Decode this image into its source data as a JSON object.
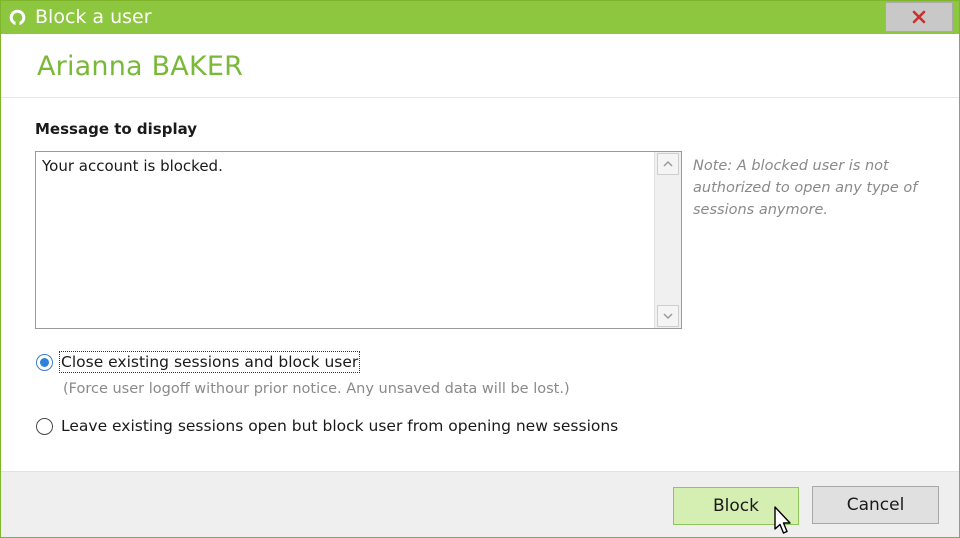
{
  "window": {
    "title": "Block a user",
    "icon": "app-logo-icon",
    "close_icon": "close-icon",
    "accent_color": "#8dc63f",
    "close_button_color": "#c9302c"
  },
  "user": {
    "name": "Arianna BAKER",
    "name_color": "#7ab83a"
  },
  "message": {
    "label": "Message to display",
    "value": "Your account is blocked."
  },
  "note": "Note: A blocked user is not authorized to open any type of sessions anymore.",
  "options": {
    "close_sessions": {
      "label": "Close existing sessions and block user",
      "hint": "(Force user logoff withour prior notice. Any unsaved data will be lost.)",
      "selected": true
    },
    "leave_sessions": {
      "label": "Leave existing sessions open but block user from opening new sessions",
      "selected": false
    }
  },
  "buttons": {
    "block_label": "Block",
    "cancel_label": "Cancel"
  }
}
